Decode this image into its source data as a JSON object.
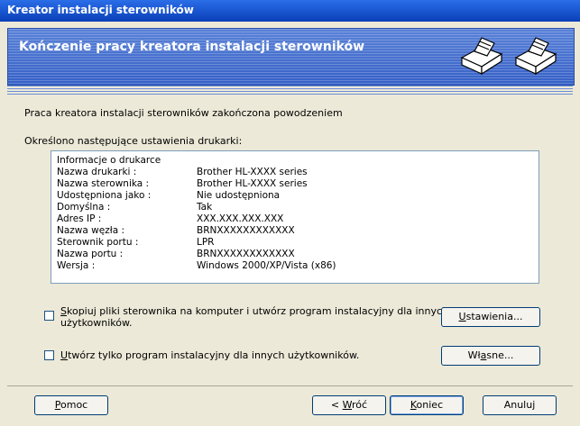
{
  "window": {
    "title": "Kreator instalacji sterowników"
  },
  "header": {
    "title": "Kończenie pracy kreatora instalacji sterowników",
    "icon": "printer-icon"
  },
  "main": {
    "status": "Praca kreatora instalacji sterowników zakończona powodzeniem",
    "settings_heading": "Określono następujące ustawienia drukarki:",
    "info": [
      {
        "key": "Informacje o drukarce",
        "value": ""
      },
      {
        "key": "Nazwa drukarki :",
        "value": "Brother HL-XXXX series"
      },
      {
        "key": "Nazwa sterownika :",
        "value": "Brother HL-XXXX series"
      },
      {
        "key": "Udostępniona jako :",
        "value": "Nie udostępniona"
      },
      {
        "key": "Domyślna :",
        "value": "Tak"
      },
      {
        "key": "Adres IP :",
        "value": "XXX.XXX.XXX.XXX"
      },
      {
        "key": "Nazwa węzła :",
        "value": "BRNXXXXXXXXXXXX"
      },
      {
        "key": "Sterownik portu :",
        "value": "LPR"
      },
      {
        "key": "Nazwa portu :",
        "value": "BRNXXXXXXXXXXXX"
      },
      {
        "key": "Wersja :",
        "value": "Windows 2000/XP/Vista (x86)"
      }
    ],
    "option1": {
      "first": "S",
      "rest1": "kopiuj pliki sterownika na komputer i utwórz program instalacyjny dla innych",
      "line2": "użytkowników.",
      "button": {
        "first": "U",
        "rest": "stawienia..."
      }
    },
    "option2": {
      "first": "U",
      "rest": "twórz tylko program instalacyjny dla innych użytkowników.",
      "button": {
        "pre": "Wł",
        "u": "a",
        "post": "sne..."
      }
    }
  },
  "footer": {
    "help": {
      "first": "P",
      "rest": "omoc"
    },
    "back": {
      "pre": "< ",
      "u": "W",
      "post": "róć"
    },
    "finish": {
      "first": "K",
      "rest": "oniec"
    },
    "cancel": "Anuluj"
  }
}
